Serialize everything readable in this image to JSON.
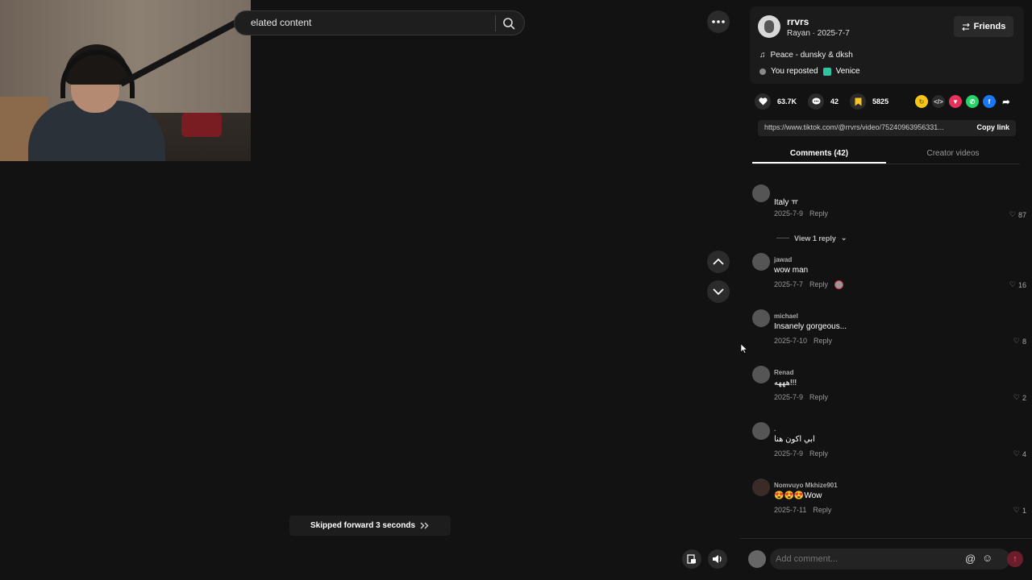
{
  "search": {
    "text": "elated content"
  },
  "toast": {
    "text": "Skipped forward 3 seconds",
    "icon": "double-chevron-right-icon"
  },
  "author": {
    "username": "rrvrs",
    "subline": "Rayan · 2025-7-7",
    "friends_label": "Friends",
    "music": "Peace - dunsky & dksh",
    "repost": "You reposted",
    "location": "Venice"
  },
  "stats": {
    "likes": "63.7K",
    "comments": "42",
    "saves": "5825"
  },
  "link": {
    "url": "https://www.tiktok.com/@rrvrs/video/75240963956331...",
    "copy_label": "Copy link"
  },
  "tabs": {
    "comments": "Comments (42)",
    "creator": "Creator videos"
  },
  "comments": [
    {
      "user": "",
      "text": "Italy ㅠ",
      "date": "2025-7-9",
      "reply": "Reply",
      "likes": "87",
      "view_reply": "View 1 reply"
    },
    {
      "user": "jawad",
      "text": "wow man",
      "date": "2025-7-7",
      "reply": "Reply",
      "likes": "16"
    },
    {
      "user": "michael",
      "text": "Insanely gorgeous...",
      "date": "2025-7-10",
      "reply": "Reply",
      "likes": "8"
    },
    {
      "user": "Renad",
      "text": "هههه!!!",
      "date": "2025-7-9",
      "reply": "Reply",
      "likes": "2"
    },
    {
      "user": ".",
      "text": "ابي اكون هنا",
      "date": "2025-7-9",
      "reply": "Reply",
      "likes": "4"
    },
    {
      "user": "Nomvuyo Mkhize901",
      "text": "😍😍😍Wow",
      "date": "2025-7-11",
      "reply": "Reply",
      "likes": "1"
    }
  ],
  "comment_bar": {
    "placeholder": "Add comment..."
  },
  "colors": {
    "background": "#121212",
    "panel": "#1b1b1b",
    "send": "#6b1d2c",
    "save": "#f7c325"
  }
}
